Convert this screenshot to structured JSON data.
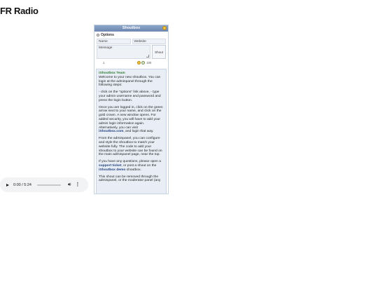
{
  "site": {
    "title": "FR Radio"
  },
  "shoutbox": {
    "title": "Shoutbox",
    "options_label": "Options",
    "name_placeholder": "Name",
    "website_placeholder": "Website",
    "message_placeholder": "Message",
    "shout_button": "Shout",
    "page_number": "1",
    "char_count": "100",
    "post": {
      "author": "iShoutbox Team",
      "p1": "Welcome to your new shoutbox. You can login at the adminpanel through the following steps:",
      "p2": "- click on the \"options\" link above, - type your admin username and password and press the login button.",
      "p3": "Once you are logged in, click on the green arrow next to your name, and click on the gold crown. A new window opens. For added security, you will have to add your admin login information again. Alternatively, you can visit",
      "p3_link": "iShoutbox.com",
      "p3_end": ", and login that way.",
      "p4": "From the adminpanel, you can configure and style the shoutbox to match your website fully. The code to add your shoutbox to your website can be found on the main adminpanel page, near the top.",
      "p5_start": "If you have any questions, please open a",
      "p5_link1": "support ticket",
      "p5_mid": ", or post a shout on the",
      "p5_link2": "iShoutbox demo",
      "p5_end": "shoutbox.",
      "p6": "This shout can be removed through the adminpanel, or the moderator panel (any"
    }
  },
  "audio": {
    "time": "0:00 / 5:24",
    "progress": 0
  }
}
